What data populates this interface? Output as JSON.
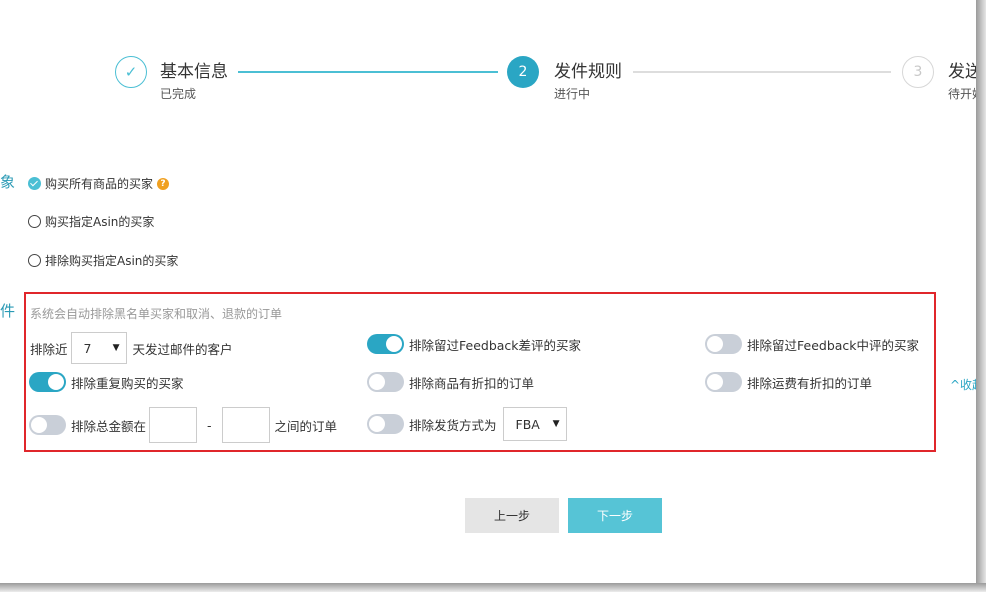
{
  "steps": [
    {
      "icon": "✓",
      "title": "基本信息",
      "sub": "已完成"
    },
    {
      "icon": "2",
      "title": "发件规则",
      "sub": "进行中"
    },
    {
      "icon": "3",
      "title": "发送时",
      "sub": "待开始"
    }
  ],
  "labels": {
    "target_cut": "象",
    "condition_cut": "件"
  },
  "target_options": [
    {
      "label": "购买所有商品的买家",
      "checked": true
    },
    {
      "label": "购买指定Asin的买家",
      "checked": false
    },
    {
      "label": "排除购买指定Asin的买家",
      "checked": false
    }
  ],
  "conditions": {
    "hint": "系统会自动排除黑名单买家和取消、退款的订单",
    "recent_prefix": "排除近",
    "recent_days": "7",
    "recent_suffix": "天发过邮件的客户",
    "exclude_negative_feedback": "排除留过Feedback差评的买家",
    "exclude_neutral_feedback": "排除留过Feedback中评的买家",
    "exclude_repeat_buyers": "排除重复购买的买家",
    "exclude_discounted_items": "排除商品有折扣的订单",
    "exclude_discounted_shipping": "排除运费有折扣的订单",
    "amount_prefix": "排除总金额在",
    "amount_dash": "-",
    "amount_suffix": "之间的订单",
    "shipping_method_prefix": "排除发货方式为",
    "shipping_method": "FBA",
    "toggles": {
      "negative_feedback": true,
      "neutral_feedback": false,
      "repeat_buyers": true,
      "discounted_items": false,
      "discounted_shipping": false,
      "amount_range": false,
      "shipping_method": false
    }
  },
  "collapse_label": "^收起",
  "buttons": {
    "prev": "上一步",
    "next": "下一步"
  },
  "colors": {
    "accent": "#2aa6c4",
    "done": "#4bbfd4",
    "highlight_border": "#e0262b"
  }
}
